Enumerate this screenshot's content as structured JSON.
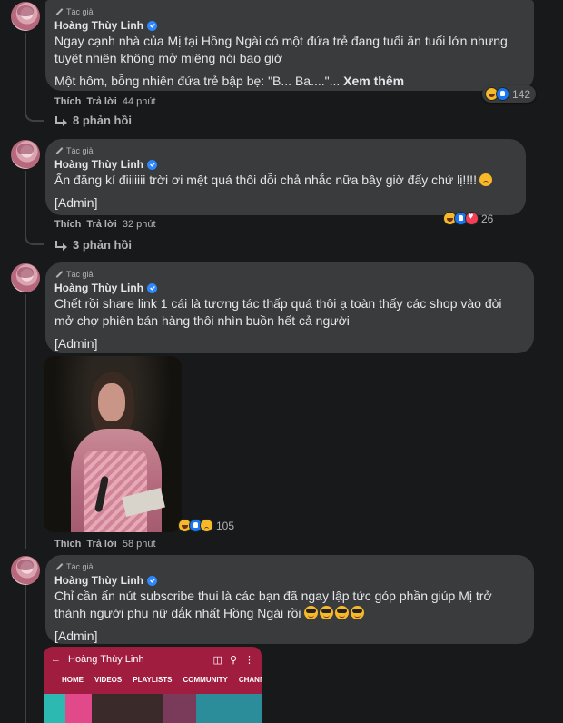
{
  "colors": {
    "background": "#18191a",
    "bubble": "#3a3b3c",
    "text": "#e4e6eb",
    "muted": "#b0b3b8",
    "verified": "#2d88ff"
  },
  "comments": [
    {
      "author_tag": "Tác giả",
      "author": "Hoàng Thùy Linh",
      "text1": "Ngay cạnh nhà của Mị tại Hồng Ngài có một đứa trẻ đang tuổi ăn tuổi lớn nhưng tuyệt nhiên không mở miệng nói bao giờ",
      "text2": "Một hôm, bỗng nhiên đứa trẻ bập bẹ: \"B... Ba....\"...",
      "see_more": "Xem thêm",
      "like": "Thích",
      "reply": "Trả lời",
      "time": "44 phút",
      "reaction_count": "142",
      "reaction_icons": [
        "haha-icon",
        "like-icon"
      ],
      "replies_label": "8 phản hồi"
    },
    {
      "author_tag": "Tác giả",
      "author": "Hoàng Thùy Linh",
      "text1": "Ấn đăng kí điiiiiii trời ơi mệt quá thôi dỗi chả nhắc nữa bây giờ đấy chứ lị!!!!",
      "emoji": "sad-emoji",
      "text2": "[Admin]",
      "like": "Thích",
      "reply": "Trả lời",
      "time": "32 phút",
      "reaction_count": "26",
      "reaction_icons": [
        "haha-icon",
        "like-icon",
        "love-icon"
      ],
      "replies_label": "3 phản hồi"
    },
    {
      "author_tag": "Tác giả",
      "author": "Hoàng Thùy Linh",
      "text1": "Chết rồi share link 1 cái là tương tác thấp quá thôi ạ toàn thấy các shop vào đòi mở chợ phiên bán hàng thôi nhìn buồn hết cả người",
      "text2": "[Admin]",
      "like": "Thích",
      "reply": "Trả lời",
      "time": "58 phút",
      "reaction_count": "105",
      "reaction_icons": [
        "haha-icon",
        "like-icon",
        "sad-icon"
      ]
    },
    {
      "author_tag": "Tác giả",
      "author": "Hoàng Thùy Linh",
      "text1": "Chỉ cần ấn nút subscribe thui là các bạn đã ngay lập tức góp phần giúp Mị trở thành người phụ nữ dắk nhất Hồng Ngài rồi",
      "emoji": "sunglasses-emoji",
      "text2": "[Admin]"
    }
  ],
  "youtube_preview": {
    "channel": "Hoàng Thùy Linh",
    "tabs": [
      "HOME",
      "VIDEOS",
      "PLAYLISTS",
      "COMMUNITY",
      "CHANN"
    ]
  }
}
